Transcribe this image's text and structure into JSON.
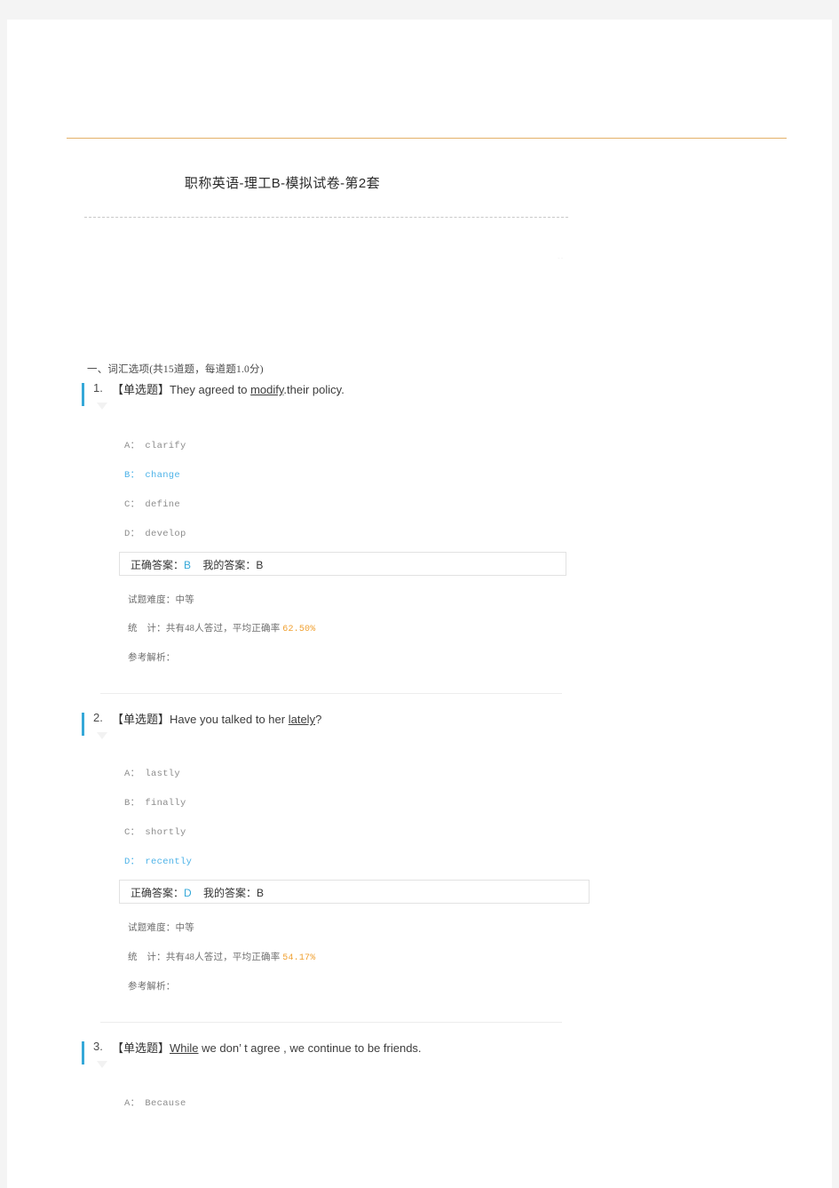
{
  "document": {
    "title": "职称英语-理工B-模拟试卷-第2套",
    "faint_mark": "--"
  },
  "section": {
    "heading": "一、词汇选项(共15道题，每道题1.0分)"
  },
  "labels": {
    "question_tag": "【单选题】",
    "correct_answer_label": "正确答案：",
    "my_answer_label": "我的答案：",
    "difficulty_label": "试题难度：",
    "stats_label": "统　计：",
    "stats_prefix": "共有",
    "stats_mid": "人答过，平均正确率 ",
    "analysis_label": "参考解析："
  },
  "colors": {
    "accent_blue": "#35a8d8",
    "percent_orange": "#f0a030",
    "gold_rule": "#e3b068",
    "page_bg": "#f4f4f4"
  },
  "questions": [
    {
      "number": "1.",
      "tag": "【单选题】",
      "stem_before": "They agreed to ",
      "stem_underlined": "modify",
      "stem_after": ".their policy.",
      "options": [
        {
          "label": "A：",
          "text": "clarify",
          "selected": false
        },
        {
          "label": "B：",
          "text": "change",
          "selected": true
        },
        {
          "label": "C：",
          "text": "define",
          "selected": false
        },
        {
          "label": "D：",
          "text": "develop",
          "selected": false
        }
      ],
      "correct_answer": "B",
      "my_answer": "B",
      "difficulty": "中等",
      "respondents": "48",
      "accuracy": "62.50%"
    },
    {
      "number": "2.",
      "tag": "【单选题】",
      "stem_before": "Have you talked to her ",
      "stem_underlined": "lately",
      "stem_after": "?",
      "options": [
        {
          "label": "A：",
          "text": "lastly",
          "selected": false
        },
        {
          "label": "B：",
          "text": "finally",
          "selected": false
        },
        {
          "label": "C：",
          "text": "shortly",
          "selected": false
        },
        {
          "label": "D：",
          "text": "recently",
          "selected": true
        }
      ],
      "correct_answer": "D",
      "my_answer": "B",
      "difficulty": "中等",
      "respondents": "48",
      "accuracy": "54.17%"
    },
    {
      "number": "3.",
      "tag": "【单选题】",
      "stem_before": "",
      "stem_underlined": "While",
      "stem_after": " we don’ t agree , we continue to be friends.",
      "options": [
        {
          "label": "A：",
          "text": "Because",
          "selected": false
        }
      ]
    }
  ]
}
